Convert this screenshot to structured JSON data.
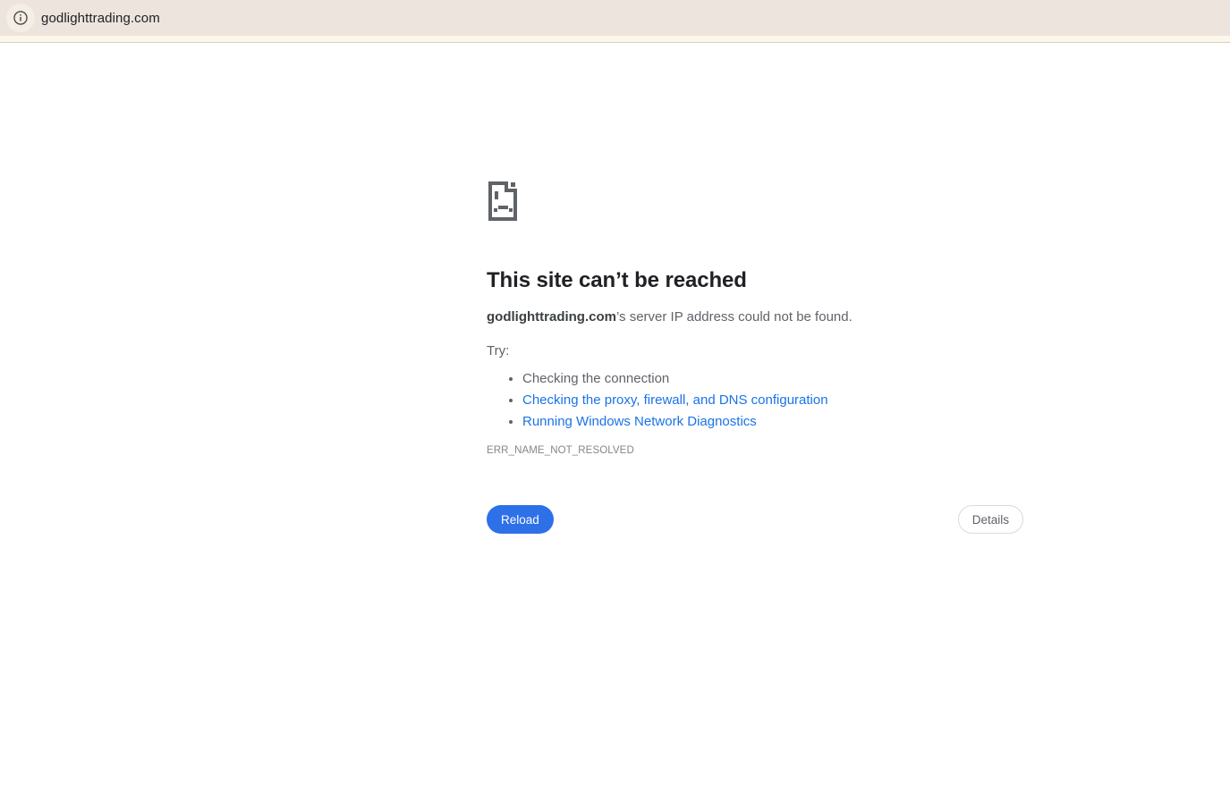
{
  "browser": {
    "address_bar": {
      "url": "godlighttrading.com",
      "info_icon": "info-icon"
    }
  },
  "error_page": {
    "icon": "sad-file-icon",
    "title": "This site can’t be reached",
    "subtitle": {
      "domain": "godlighttrading.com",
      "rest": "’s server IP address could not be found."
    },
    "try_label": "Try:",
    "suggestions": [
      {
        "label": "Checking the connection",
        "is_link": false
      },
      {
        "label": "Checking the proxy, firewall, and DNS configuration",
        "is_link": true
      },
      {
        "label": "Running Windows Network Diagnostics",
        "is_link": true
      }
    ],
    "error_code": "ERR_NAME_NOT_RESOLVED",
    "buttons": {
      "reload": "Reload",
      "details": "Details"
    }
  },
  "colors": {
    "toolbar_bg": "#ece4dd",
    "bookmarks_strip_bg": "#fdf6ea",
    "strip_border": "#d9d0bd",
    "link_blue": "#1a73e8",
    "reload_button_bg": "#2e70e8",
    "heading_text": "#202124",
    "secondary_text": "#5f6368",
    "error_code_text": "#81878c"
  }
}
